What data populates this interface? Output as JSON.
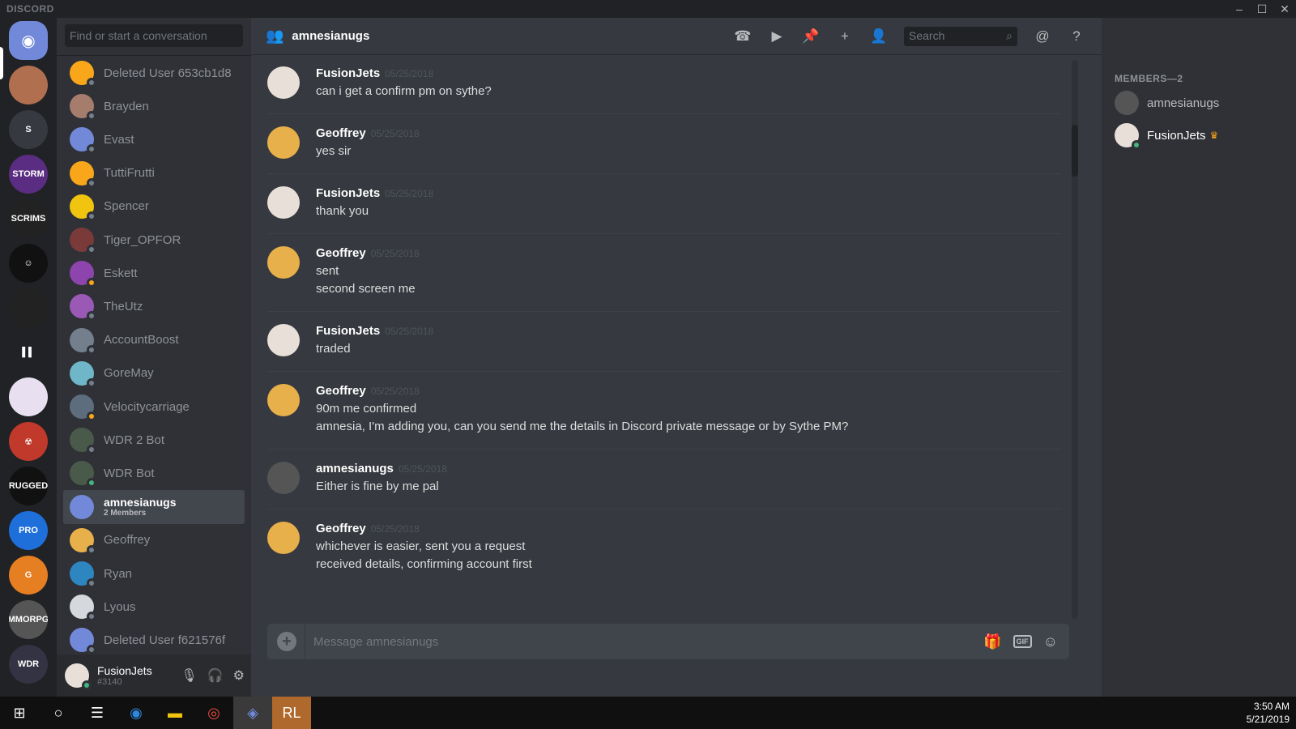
{
  "app": {
    "brand": "DISCORD"
  },
  "window_controls": {
    "minimize": "–",
    "maximize": "☐",
    "close": "✕"
  },
  "guilds": [
    {
      "name": "home",
      "label": "",
      "color": "#7289da"
    },
    {
      "name": "server-avatar-face",
      "label": "",
      "color": "#b07050"
    },
    {
      "name": "server-s",
      "label": "S",
      "color": "#36393f"
    },
    {
      "name": "server-storm",
      "label": "STORM",
      "color": "#5a2d82"
    },
    {
      "name": "server-default-scrims",
      "label": "SCRIMS",
      "color": "#222"
    },
    {
      "name": "server-smiley",
      "label": "☺",
      "color": "#111"
    },
    {
      "name": "server-dark",
      "label": "",
      "color": "#222"
    },
    {
      "name": "server-bars",
      "label": "▌▌",
      "color": "#202225"
    },
    {
      "name": "server-pink",
      "label": "",
      "color": "#e8e0f0"
    },
    {
      "name": "server-red",
      "label": "☢",
      "color": "#c0392b"
    },
    {
      "name": "server-rugged",
      "label": "RUGGED",
      "color": "#111"
    },
    {
      "name": "server-pro-scrims",
      "label": "PRO",
      "color": "#1e6fd9"
    },
    {
      "name": "server-orange",
      "label": "G",
      "color": "#e67e22"
    },
    {
      "name": "server-mmorpg",
      "label": "MMORPG",
      "color": "#555"
    },
    {
      "name": "server-wdr",
      "label": "WDR",
      "color": "#334"
    }
  ],
  "dm_search": {
    "placeholder": "Find or start a conversation"
  },
  "dms": [
    {
      "name": "Deleted User 653cb1d8",
      "color": "#faa61a",
      "status": "offline"
    },
    {
      "name": "Brayden",
      "color": "#a67c6d",
      "status": "offline"
    },
    {
      "name": "Evast",
      "color": "#7289da",
      "status": "offline"
    },
    {
      "name": "TuttiFrutti",
      "color": "#faa61a",
      "status": "offline"
    },
    {
      "name": "Spencer",
      "color": "#f1c40f",
      "status": "offline"
    },
    {
      "name": "Tiger_OPFOR",
      "color": "#7a3a3a",
      "status": "offline"
    },
    {
      "name": "Eskett",
      "color": "#8e44ad",
      "status": "idle"
    },
    {
      "name": "TheUtz",
      "color": "#9b59b6",
      "status": "offline"
    },
    {
      "name": "AccountBoost",
      "color": "#747f8d",
      "status": "offline"
    },
    {
      "name": "GoreMay",
      "color": "#6fb7c8",
      "status": "offline"
    },
    {
      "name": "Velocitycarriage",
      "color": "#5d6d7e",
      "status": "idle"
    },
    {
      "name": "WDR 2 Bot",
      "color": "#4a5a4a",
      "status": "offline"
    },
    {
      "name": "WDR Bot",
      "color": "#4a5a4a",
      "status": "online"
    },
    {
      "name": "amnesianugs",
      "sub": "2 Members",
      "color": "#7289da",
      "status": "none",
      "active": true
    },
    {
      "name": "Geoffrey",
      "color": "#e8b04a",
      "status": "offline"
    },
    {
      "name": "Ryan",
      "color": "#2e86c1",
      "status": "offline"
    },
    {
      "name": "Lyous",
      "color": "#d5d8dc",
      "status": "offline"
    },
    {
      "name": "Deleted User f621576f",
      "color": "#7289da",
      "status": "offline"
    }
  ],
  "user_panel": {
    "name": "FusionJets",
    "tag": "#3140"
  },
  "header": {
    "title": "amnesianugs"
  },
  "header_search": {
    "placeholder": "Search"
  },
  "messages": [
    {
      "author": "FusionJets",
      "time": "05/25/2018",
      "lines": [
        "can i get a confirm pm on sythe?"
      ]
    },
    {
      "author": "Geoffrey",
      "time": "05/25/2018",
      "lines": [
        "yes sir"
      ]
    },
    {
      "author": "FusionJets",
      "time": "05/25/2018",
      "lines": [
        "thank you"
      ]
    },
    {
      "author": "Geoffrey",
      "time": "05/25/2018",
      "lines": [
        "sent",
        "second screen me"
      ]
    },
    {
      "author": "FusionJets",
      "time": "05/25/2018",
      "lines": [
        "traded"
      ]
    },
    {
      "author": "Geoffrey",
      "time": "05/25/2018",
      "lines": [
        "90m me confirmed",
        "amnesia, I'm adding you, can you send me the details in Discord private message or by Sythe PM?"
      ]
    },
    {
      "author": "amnesianugs",
      "time": "05/25/2018",
      "lines": [
        "Either is fine by me pal"
      ]
    },
    {
      "author": "Geoffrey",
      "time": "05/25/2018",
      "lines": [
        "whichever is easier, sent you a request",
        "received details, confirming account first"
      ]
    }
  ],
  "composer": {
    "placeholder": "Message amnesianugs",
    "gif_label": "GIF"
  },
  "members": {
    "heading": "MEMBERS—2",
    "list": [
      {
        "name": "amnesianugs",
        "owner": false,
        "status": "none"
      },
      {
        "name": "FusionJets",
        "owner": true,
        "status": "online"
      }
    ]
  },
  "taskbar": {
    "time": "3:50 AM",
    "date": "5/21/2019"
  },
  "colors": {
    "accent": "#7289da",
    "online": "#43b581",
    "idle": "#faa61a",
    "offline": "#747f8d"
  }
}
